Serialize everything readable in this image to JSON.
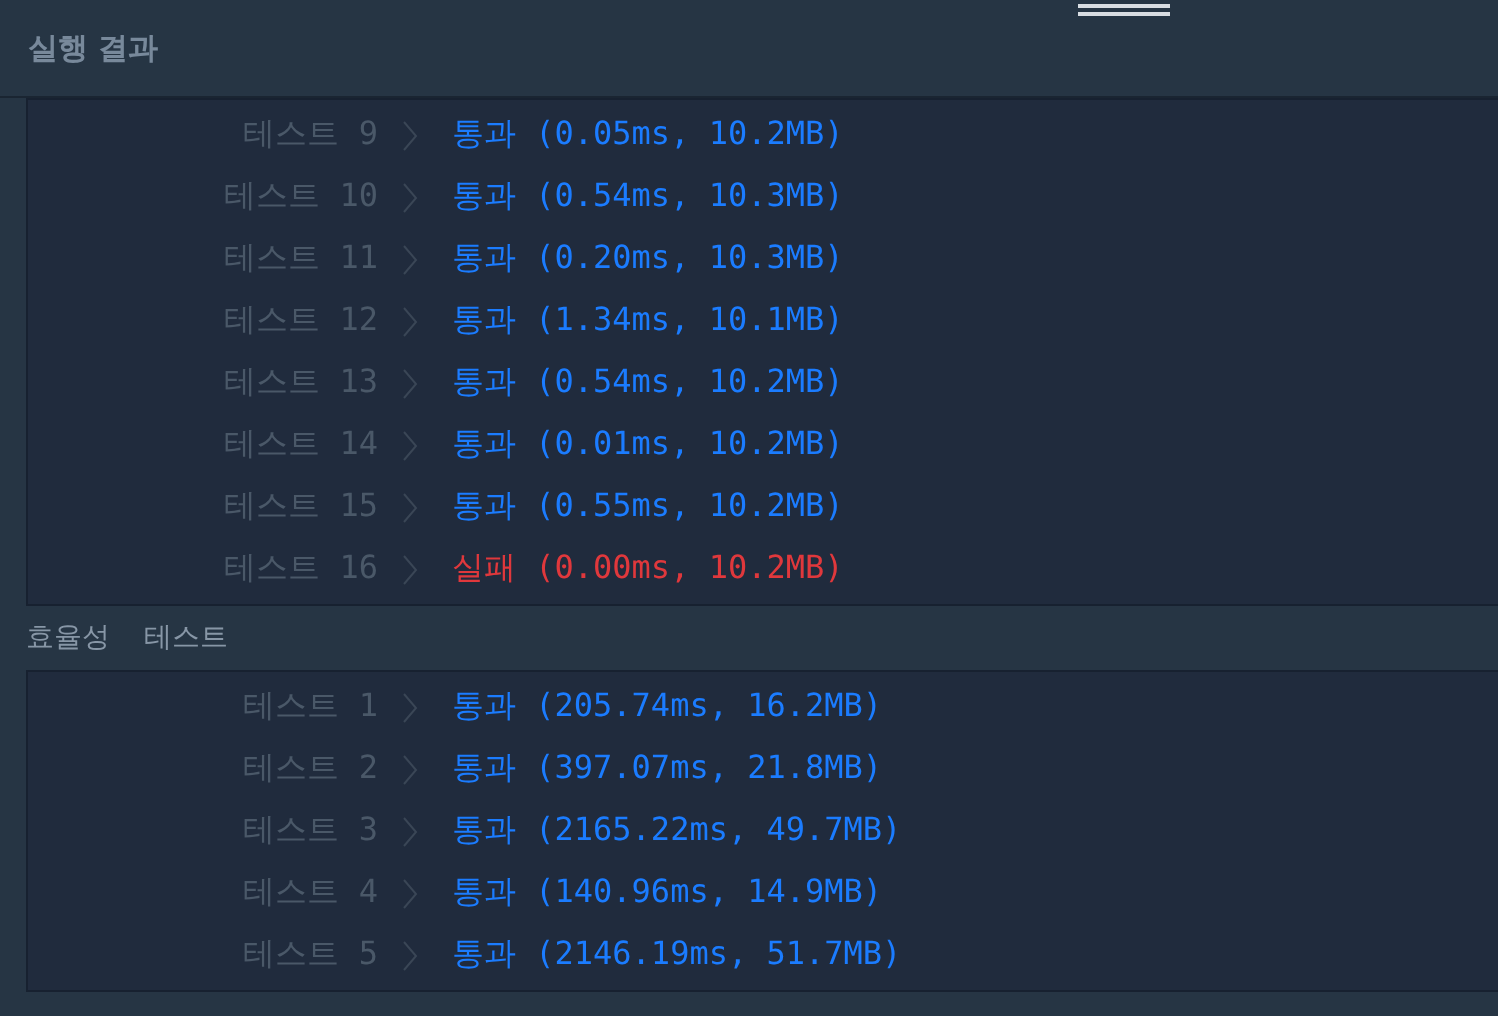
{
  "header": {
    "title": "실행 결과"
  },
  "sections": [
    {
      "rows": [
        {
          "label": "테스트 9",
          "result": "통과",
          "detail": "(0.05ms, 10.2MB)",
          "kind": "pass"
        },
        {
          "label": "테스트 10",
          "result": "통과",
          "detail": "(0.54ms, 10.3MB)",
          "kind": "pass"
        },
        {
          "label": "테스트 11",
          "result": "통과",
          "detail": "(0.20ms, 10.3MB)",
          "kind": "pass"
        },
        {
          "label": "테스트 12",
          "result": "통과",
          "detail": "(1.34ms, 10.1MB)",
          "kind": "pass"
        },
        {
          "label": "테스트 13",
          "result": "통과",
          "detail": "(0.54ms, 10.2MB)",
          "kind": "pass"
        },
        {
          "label": "테스트 14",
          "result": "통과",
          "detail": "(0.01ms, 10.2MB)",
          "kind": "pass"
        },
        {
          "label": "테스트 15",
          "result": "통과",
          "detail": "(0.55ms, 10.2MB)",
          "kind": "pass"
        },
        {
          "label": "테스트 16",
          "result": "실패",
          "detail": "(0.00ms, 10.2MB)",
          "kind": "fail"
        }
      ]
    },
    {
      "label": "효율성  테스트",
      "rows": [
        {
          "label": "테스트 1",
          "result": "통과",
          "detail": "(205.74ms, 16.2MB)",
          "kind": "pass"
        },
        {
          "label": "테스트 2",
          "result": "통과",
          "detail": "(397.07ms, 21.8MB)",
          "kind": "pass"
        },
        {
          "label": "테스트 3",
          "result": "통과",
          "detail": "(2165.22ms, 49.7MB)",
          "kind": "pass"
        },
        {
          "label": "테스트 4",
          "result": "통과",
          "detail": "(140.96ms, 14.9MB)",
          "kind": "pass"
        },
        {
          "label": "테스트 5",
          "result": "통과",
          "detail": "(2146.19ms, 51.7MB)",
          "kind": "pass"
        }
      ]
    }
  ]
}
